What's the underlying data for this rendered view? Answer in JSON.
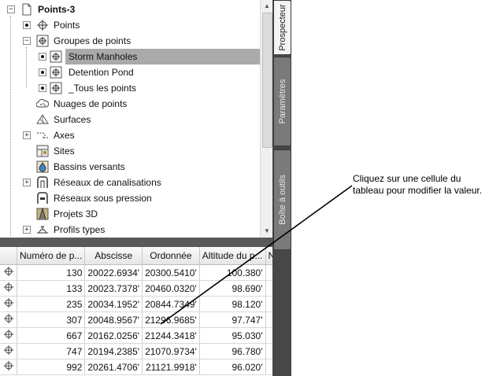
{
  "tree": {
    "root": {
      "label": "Points-3",
      "icon": "drawing-icon"
    },
    "items": [
      {
        "label": "Points",
        "icon": "point-icon"
      },
      {
        "label": "Groupes de points",
        "icon": "point-group-icon"
      },
      {
        "label": "Storm Manholes",
        "icon": "point-group-icon"
      },
      {
        "label": "Detention Pond",
        "icon": "point-group-icon"
      },
      {
        "label": "_Tous les points",
        "icon": "point-group-icon"
      },
      {
        "label": "Nuages de points",
        "icon": "point-cloud-icon"
      },
      {
        "label": "Surfaces",
        "icon": "surface-icon"
      },
      {
        "label": "Axes",
        "icon": "alignment-icon"
      },
      {
        "label": "Sites",
        "icon": "site-icon"
      },
      {
        "label": "Bassins versants",
        "icon": "catchment-icon"
      },
      {
        "label": "Réseaux de canalisations",
        "icon": "pipe-network-icon"
      },
      {
        "label": "Réseaux sous pression",
        "icon": "pressure-network-icon"
      },
      {
        "label": "Projets 3D",
        "icon": "corridor-icon"
      },
      {
        "label": "Profils types",
        "icon": "assembly-icon"
      }
    ],
    "selected": "Storm Manholes"
  },
  "tabs": [
    {
      "label": "Prospecteur",
      "active": true
    },
    {
      "label": "Paramètres",
      "active": false
    },
    {
      "label": "Boîte à outils",
      "active": false
    }
  ],
  "grid": {
    "columns": [
      "",
      "Numéro de p...",
      "Abscisse",
      "Ordonnée",
      "Altitude du p...",
      "No"
    ],
    "rows": [
      [
        "130",
        "20022.6934'",
        "20300.5410'",
        "100.380'"
      ],
      [
        "133",
        "20023.7378'",
        "20460.0320'",
        "98.690'"
      ],
      [
        "235",
        "20034.1952'",
        "20844.7349'",
        "98.120'"
      ],
      [
        "307",
        "20048.9567'",
        "21296.9685'",
        "97.747'"
      ],
      [
        "667",
        "20162.0256'",
        "21244.3418'",
        "95.030'"
      ],
      [
        "747",
        "20194.2385'",
        "21070.9734'",
        "96.780'"
      ],
      [
        "992",
        "20261.4706'",
        "21121.9918'",
        "96.020'"
      ]
    ]
  },
  "callout": {
    "text": "Cliquez sur une cellule du tableau pour modifier la valeur."
  },
  "colors": {
    "selection": "#aaaaaa",
    "panel_dark": "#474747",
    "tab_active": "#f3f3f3"
  }
}
